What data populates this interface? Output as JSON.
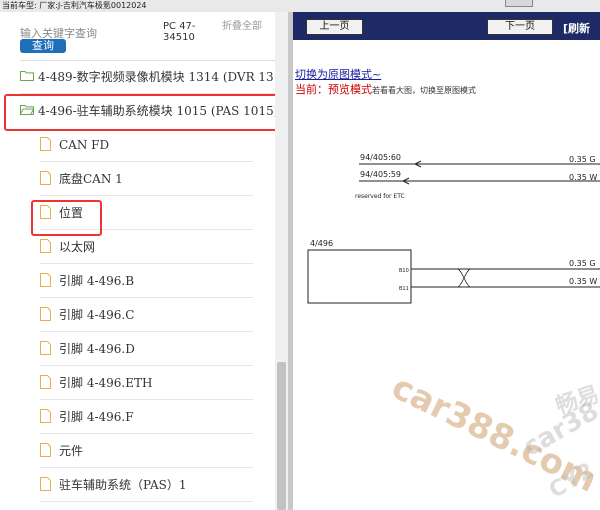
{
  "top_bar": {
    "text": "当前车型:   厂家:J-吉利汽车极氪0012024"
  },
  "search": {
    "placeholder": "输入关键字查询",
    "query_button": "查询",
    "pc_code": "PC 47-34510",
    "collapse_label": "折叠全部"
  },
  "tree": {
    "folders": [
      {
        "label": "4-489-数字视频录像机模块 1314 (DVR 1314)"
      },
      {
        "label": "4-496-驻车辅助系统模块 1015 (PAS 1015)"
      }
    ],
    "items": [
      {
        "label": "CAN FD"
      },
      {
        "label": "底盘CAN 1"
      },
      {
        "label": "位置"
      },
      {
        "label": "以太网"
      },
      {
        "label": "引脚 4-496.B"
      },
      {
        "label": "引脚 4-496.C"
      },
      {
        "label": "引脚 4-496.D"
      },
      {
        "label": "引脚 4-496.ETH"
      },
      {
        "label": "引脚 4-496.F"
      },
      {
        "label": "元件"
      },
      {
        "label": "驻车辅助系统（PAS）1"
      }
    ]
  },
  "viewer": {
    "prev_button": "上一页",
    "next_button": "下一页",
    "refresh_label": "[刷新",
    "switch_link": "切换为原图模式~",
    "current_prefix": "当前：",
    "current_mode": "预览模式",
    "current_hint": "若看看大图，切换至原图模式",
    "diagram": {
      "conn1": "94/405:60",
      "conn2": "94/405:59",
      "reserved": "reserved for ETC",
      "wire1": "0.35 G",
      "wire2": "0.35 W",
      "module": "4/496",
      "pin1": "B10",
      "pin2": "B11",
      "wire3": "0.35 G",
      "wire4": "0.35 W"
    },
    "watermark1": "car388.com",
    "watermark2": "car38",
    "watermark3": "畅易",
    "watermark4": "CY2"
  },
  "colors": {
    "nav_bg": "#1d2a66",
    "query_btn": "#1f6fb8",
    "highlight": "#e33333",
    "folder": "#6aa84f",
    "file": "#e8b04a"
  }
}
